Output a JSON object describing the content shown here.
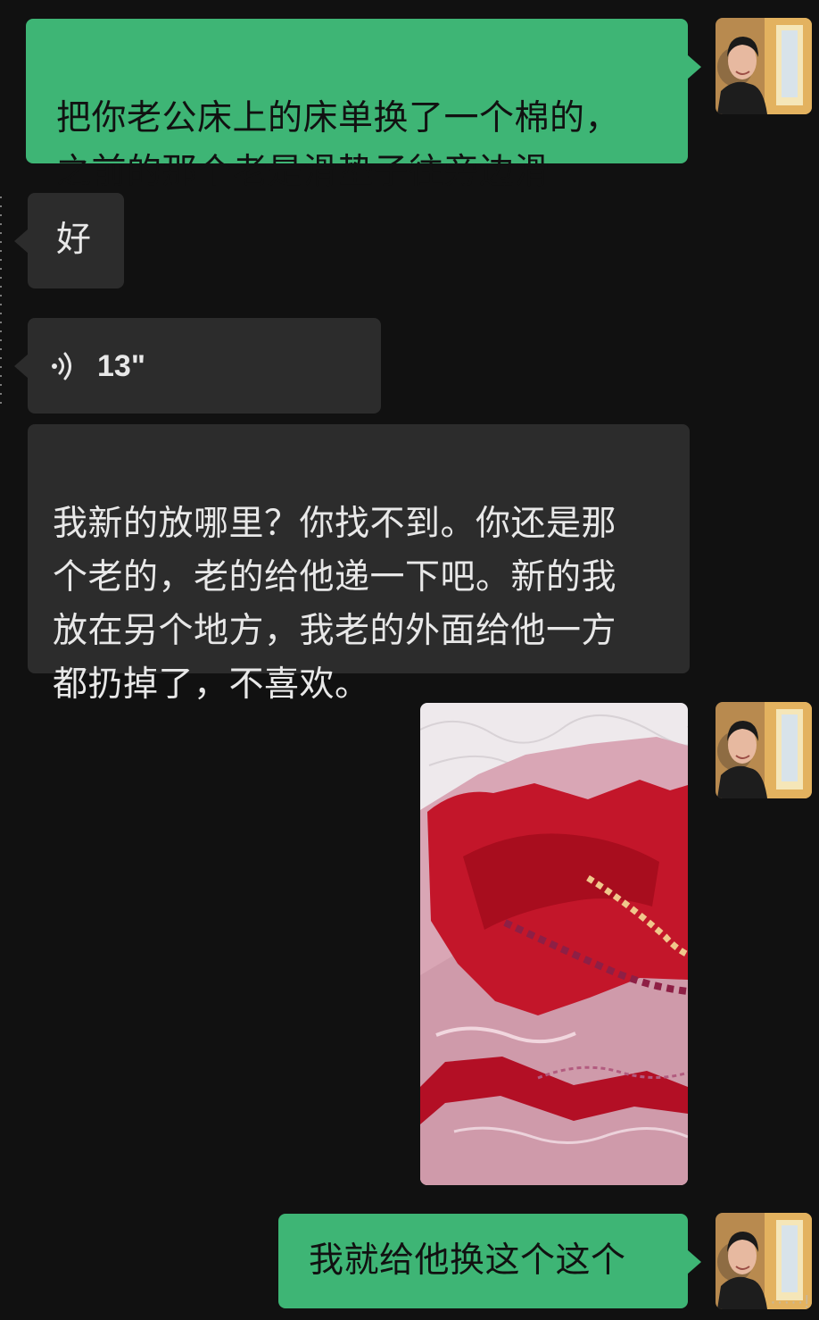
{
  "chat": {
    "messages": [
      {
        "type": "text",
        "side": "sent",
        "text": "把你老公床上的床单换了一个棉的，\n之前的那个老是滑垫子往旁边滑"
      },
      {
        "type": "text",
        "side": "received",
        "text": "好"
      },
      {
        "type": "voice",
        "side": "received",
        "duration": "13\""
      },
      {
        "type": "text",
        "side": "received",
        "text": "我新的放哪里？你找不到。你还是那\n个老的，老的给他递一下吧。新的我\n放在另个地方，我老的外面给他一方\n都扔掉了，不喜欢。"
      },
      {
        "type": "image",
        "side": "sent",
        "image_content": "folded pink and red bed sheet"
      },
      {
        "type": "text",
        "side": "sent",
        "text": "我就给他换这个这个"
      }
    ]
  },
  "watermark": "·····!",
  "colors": {
    "background": "#111111",
    "sent_bubble": "#3eb575",
    "received_bubble": "#2c2c2c"
  }
}
